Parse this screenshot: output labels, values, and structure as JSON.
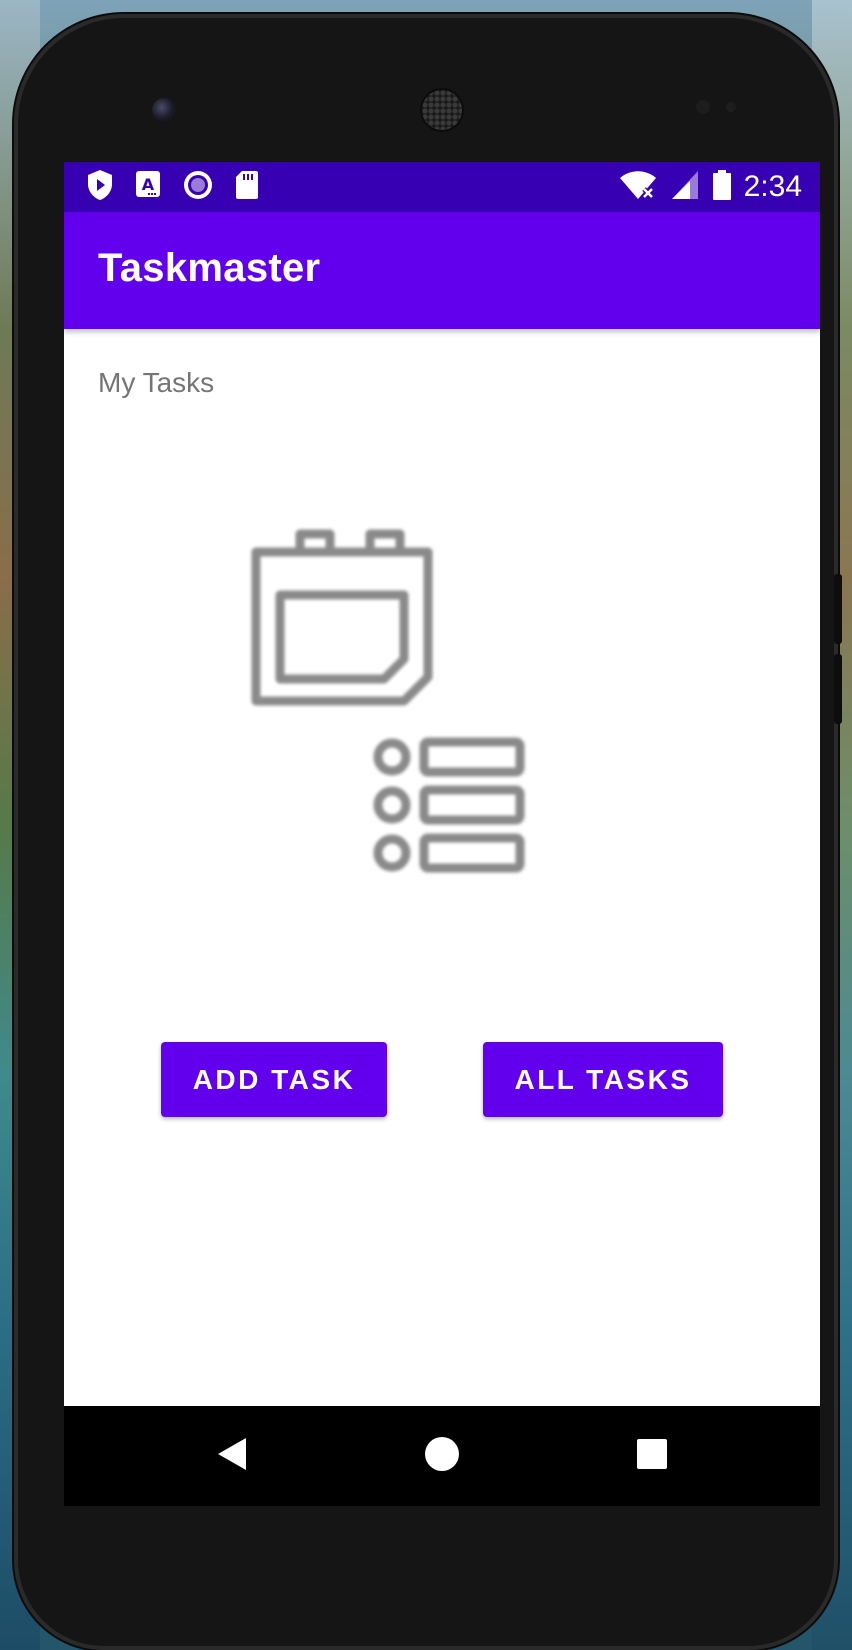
{
  "status_bar": {
    "time": "2:34",
    "left_icons": [
      "play-protect-icon",
      "font-a-icon",
      "record-circle-icon",
      "sd-card-icon"
    ],
    "right_icons": [
      "wifi-off-icon",
      "cell-signal-icon",
      "battery-icon"
    ]
  },
  "app_bar": {
    "title": "Taskmaster"
  },
  "main": {
    "heading": "My Tasks",
    "illustration_icon": "calendar-task-list-icon",
    "buttons": {
      "add_task": "ADD TASK",
      "all_tasks": "ALL TASKS"
    }
  },
  "nav_bar": {
    "icons": [
      "back-triangle-icon",
      "home-circle-icon",
      "recents-square-icon"
    ]
  },
  "colors": {
    "primary": "#6200ee",
    "primary_dark": "#3700b3",
    "subtitle_text": "#757575",
    "icon_gray": "#8a8a8a"
  }
}
